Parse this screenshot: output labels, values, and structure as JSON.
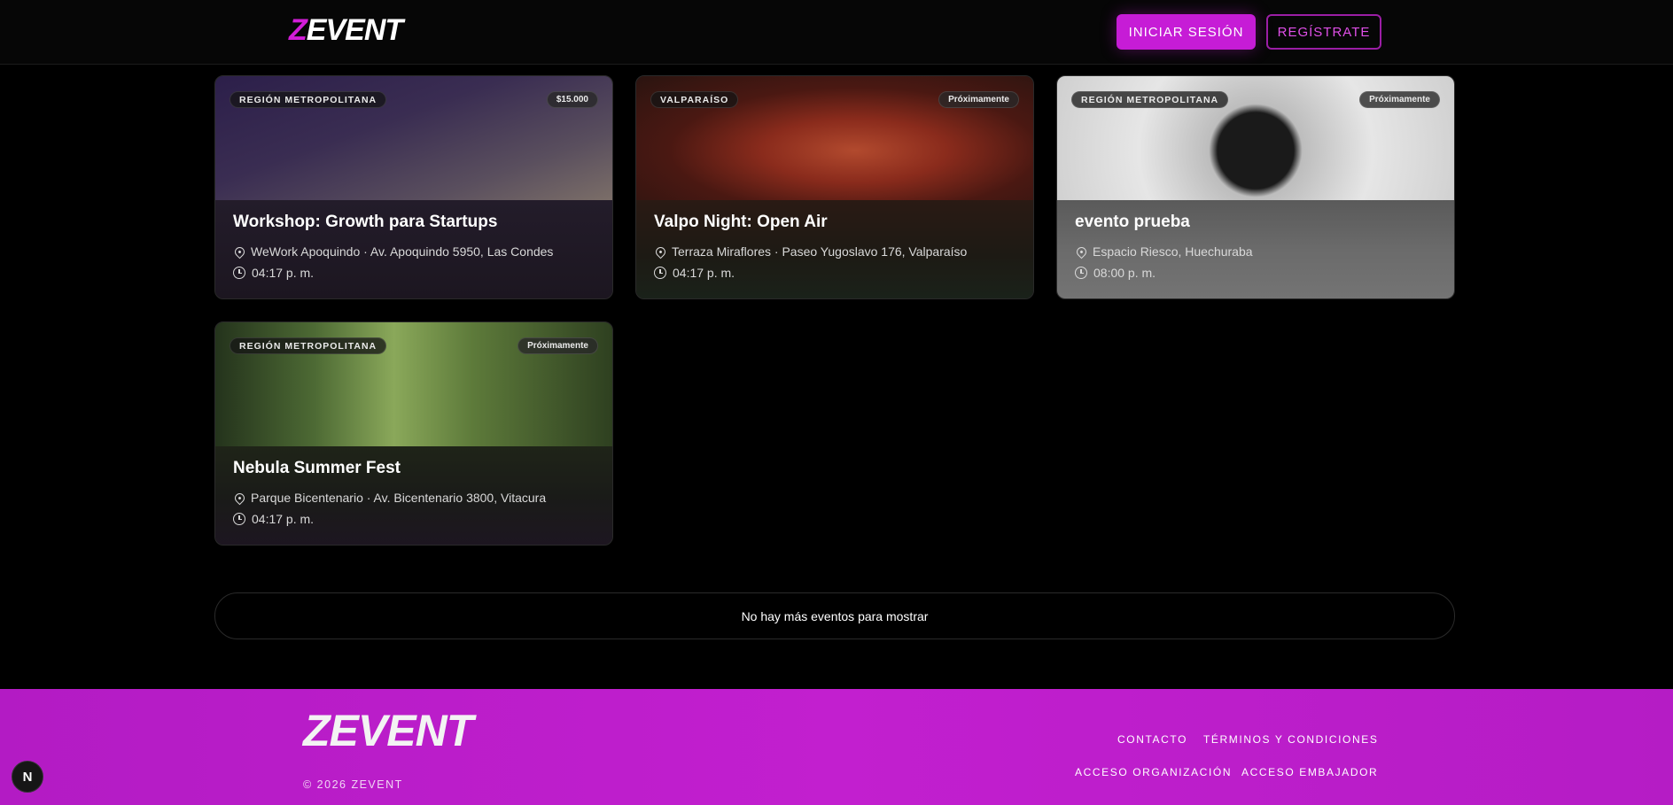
{
  "header": {
    "logo_text": "EVENT",
    "logo_mark": "Z",
    "login_label": "INICIAR SESIÓN",
    "register_label": "REGÍSTRATE"
  },
  "events": [
    {
      "region": "REGIÓN METROPOLITANA",
      "tag": "$15.000",
      "title": "Workshop: Growth para Startups",
      "location": "WeWork Apoquindo · Av. Apoquindo 5950, Las Condes",
      "time": "04:17 p. m."
    },
    {
      "region": "VALPARAÍSO",
      "tag": "Próximamente",
      "title": "Valpo Night: Open Air",
      "location": "Terraza Miraflores · Paseo Yugoslavo 176, Valparaíso",
      "time": "04:17 p. m."
    },
    {
      "region": "REGIÓN METROPOLITANA",
      "tag": "Próximamente",
      "title": "evento prueba",
      "location": "Espacio Riesco, Huechuraba",
      "time": "08:00 p. m."
    },
    {
      "region": "REGIÓN METROPOLITANA",
      "tag": "Próximamente",
      "title": "Nebula Summer Fest",
      "location": "Parque Bicentenario · Av. Bicentenario 3800, Vitacura",
      "time": "04:17 p. m."
    }
  ],
  "end_message": "No hay más eventos para mostrar",
  "footer": {
    "logo_text": "EVENT",
    "logo_mark": "Z",
    "copyright": "© 2026 ZEVENT",
    "links": {
      "contact": "CONTACTO",
      "terms": "TÉRMINOS Y CONDICIONES",
      "org_access": "ACCESO ORGANIZACIÓN",
      "ambassador_access": "ACCESO EMBAJADOR"
    }
  },
  "dev_badge": "N",
  "colors": {
    "accent": "#c61cd6",
    "footer_bg": "#b81cc8",
    "background": "#000000"
  }
}
